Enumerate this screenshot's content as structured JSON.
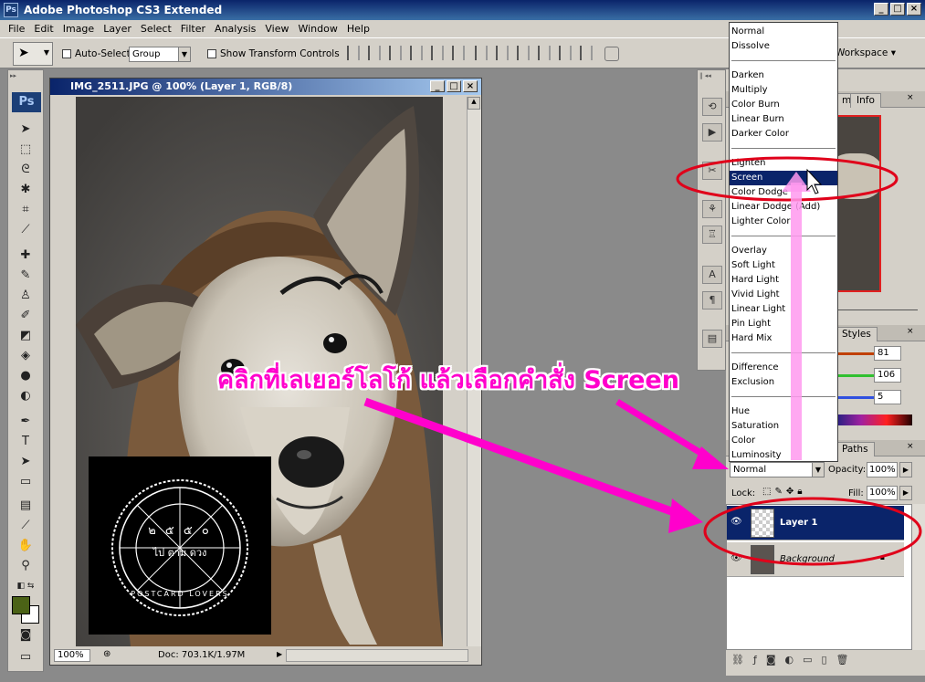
{
  "app": {
    "title": "Adobe Photoshop CS3 Extended",
    "ps_badge": "Ps",
    "window_buttons": [
      "_",
      "□",
      "×"
    ]
  },
  "menu": [
    "File",
    "Edit",
    "Image",
    "Layer",
    "Select",
    "Filter",
    "Analysis",
    "View",
    "Window",
    "Help"
  ],
  "options": {
    "auto_select_label": "Auto-Select:",
    "auto_select_value": "Group",
    "show_transform_label": "Show Transform Controls",
    "workspace_label": "Workspace ▾"
  },
  "toolbox": {
    "logo": "Ps"
  },
  "document": {
    "title": "IMG_2511.JPG @ 100% (Layer 1, RGB/8)",
    "zoom": "100%",
    "doc_size": "Doc: 703.1K/1.97M",
    "seal_text_top": "๒ ๕ ๕ ๐",
    "seal_text_mid": "ไป ตาม ดวง",
    "seal_text_bottom": "POSTCARD LOVERS"
  },
  "panels": {
    "navigator_tabs": [
      "m",
      "Info"
    ],
    "color_tabs": [
      "Styles"
    ],
    "color_values": [
      "81",
      "106",
      "5"
    ],
    "layers_tabs": [
      "Paths"
    ],
    "blend_mode": "Normal",
    "opacity_label": "Opacity:",
    "opacity_value": "100%",
    "lock_label": "Lock:",
    "fill_label": "Fill:",
    "fill_value": "100%",
    "layers": [
      {
        "name": "Layer 1",
        "selected": true
      },
      {
        "name": "Background",
        "selected": false
      }
    ]
  },
  "blend_menu": {
    "groups": [
      [
        "Normal",
        "Dissolve"
      ],
      [
        "Darken",
        "Multiply",
        "Color Burn",
        "Linear Burn",
        "Darker Color"
      ],
      [
        "Lighten",
        "Screen",
        "Color Dodge",
        "Linear Dodge (Add)",
        "Lighter Color"
      ],
      [
        "Overlay",
        "Soft Light",
        "Hard Light",
        "Vivid Light",
        "Linear Light",
        "Pin Light",
        "Hard Mix"
      ],
      [
        "Difference",
        "Exclusion"
      ],
      [
        "Hue",
        "Saturation",
        "Color",
        "Luminosity"
      ]
    ],
    "selected": "Screen"
  },
  "annotation": {
    "text": "คลิกที่เลเยอร์โลโก้ แล้วเลือกคำสั่ง Screen"
  },
  "colors": {
    "annotation": "#ff00cc",
    "highlight": "#0a246a",
    "ellipse": "#e0001a"
  }
}
